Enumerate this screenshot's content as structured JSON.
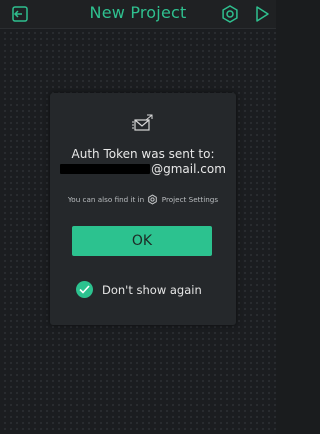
{
  "header": {
    "title": "New Project",
    "back_icon": "exit-project-icon",
    "settings_icon": "gear-icon",
    "play_icon": "play-icon",
    "accent_color": "#2fc08f"
  },
  "dialog": {
    "icon": "mail-sent-icon",
    "message_line1": "Auth Token was sent to:",
    "email_suffix": "@gmail.com",
    "hint_prefix": "You can also find it in",
    "hint_icon": "gear-icon",
    "hint_suffix": "Project Settings",
    "ok_label": "OK",
    "checkbox_label": "Don't show again",
    "checkbox_checked": true,
    "button_color": "#2cc28f"
  }
}
